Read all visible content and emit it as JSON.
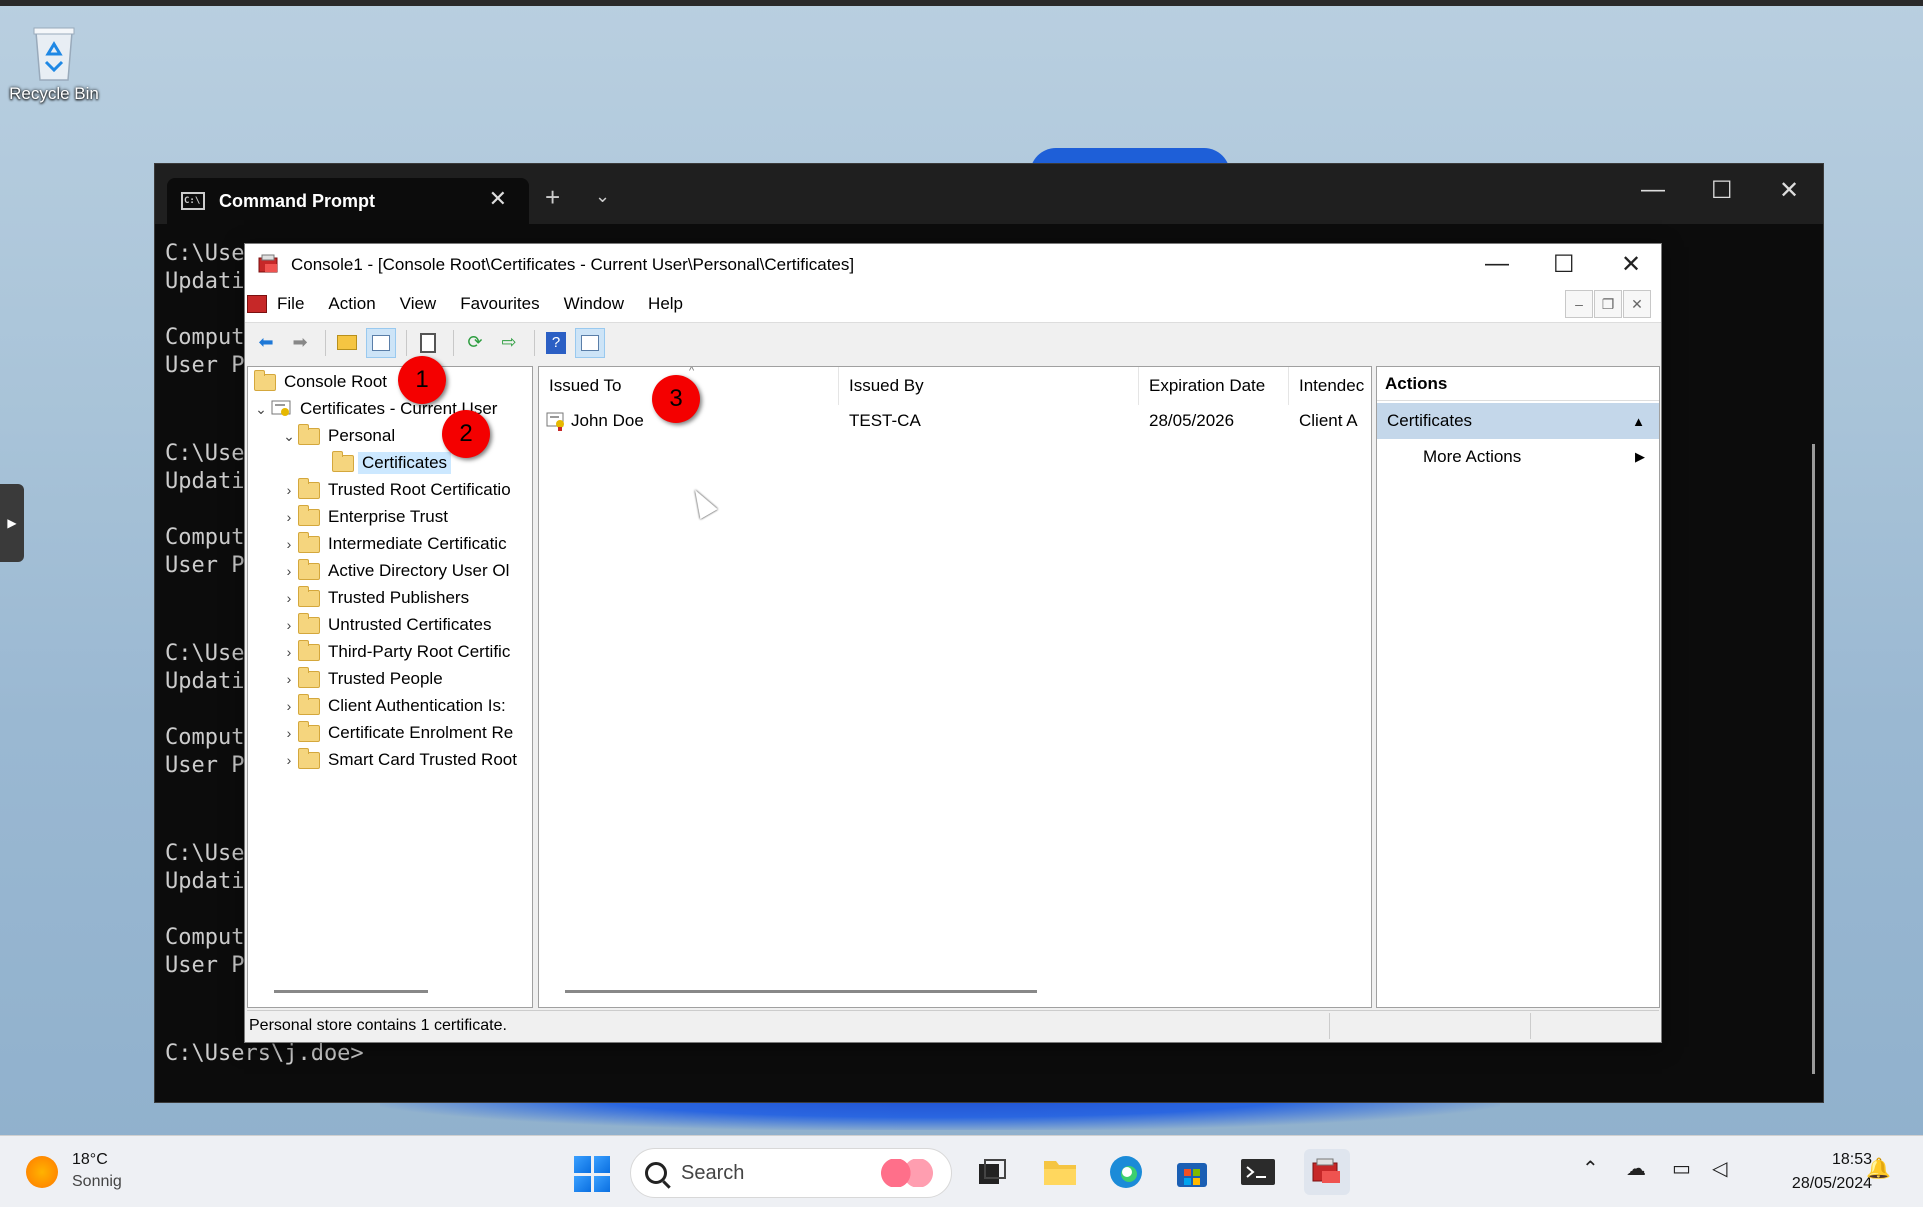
{
  "desktop": {
    "recycle_bin_label": "Recycle Bin"
  },
  "terminal": {
    "tab_title": "Command Prompt",
    "lines": [
      "C:\\Use",
      "Updati",
      "Comput",
      "User P",
      "C:\\Use",
      "Updati",
      "Comput",
      "User P",
      "C:\\Use",
      "Updati",
      "Comput",
      "User P",
      "C:\\Use",
      "Updati",
      "Comput",
      "User P"
    ],
    "prompt": "C:\\Users\\j.doe>"
  },
  "mmc": {
    "title": "Console1 - [Console Root\\Certificates - Current User\\Personal\\Certificates]",
    "menu": [
      "File",
      "Action",
      "View",
      "Favourites",
      "Window",
      "Help"
    ],
    "tree": {
      "root": "Console Root",
      "snapin": "Certificates - Current User",
      "personal": "Personal",
      "selected": "Certificates",
      "stores": [
        "Trusted Root Certificatio",
        "Enterprise Trust",
        "Intermediate Certificatic",
        "Active Directory User Ol",
        "Trusted Publishers",
        "Untrusted Certificates",
        "Third-Party Root Certific",
        "Trusted People",
        "Client Authentication Is:",
        "Certificate Enrolment Re",
        "Smart Card Trusted Root"
      ]
    },
    "list": {
      "columns": [
        "Issued To",
        "Issued By",
        "Expiration Date",
        "Intendec"
      ],
      "rows": [
        {
          "issued_to": "John Doe",
          "issued_by": "TEST-CA",
          "expiration": "28/05/2026",
          "intended": "Client A"
        }
      ]
    },
    "actions": {
      "header": "Actions",
      "group": "Certificates",
      "more": "More Actions"
    },
    "status": "Personal store contains 1 certificate."
  },
  "annotations": [
    "1",
    "2",
    "3"
  ],
  "taskbar": {
    "temp": "18°C",
    "weather": "Sonnig",
    "search_placeholder": "Search",
    "time": "18:53",
    "date": "28/05/2024"
  },
  "colors": {
    "badge": "#f40000",
    "selection": "#cce8ff",
    "actions_group": "#c4d7ea"
  }
}
